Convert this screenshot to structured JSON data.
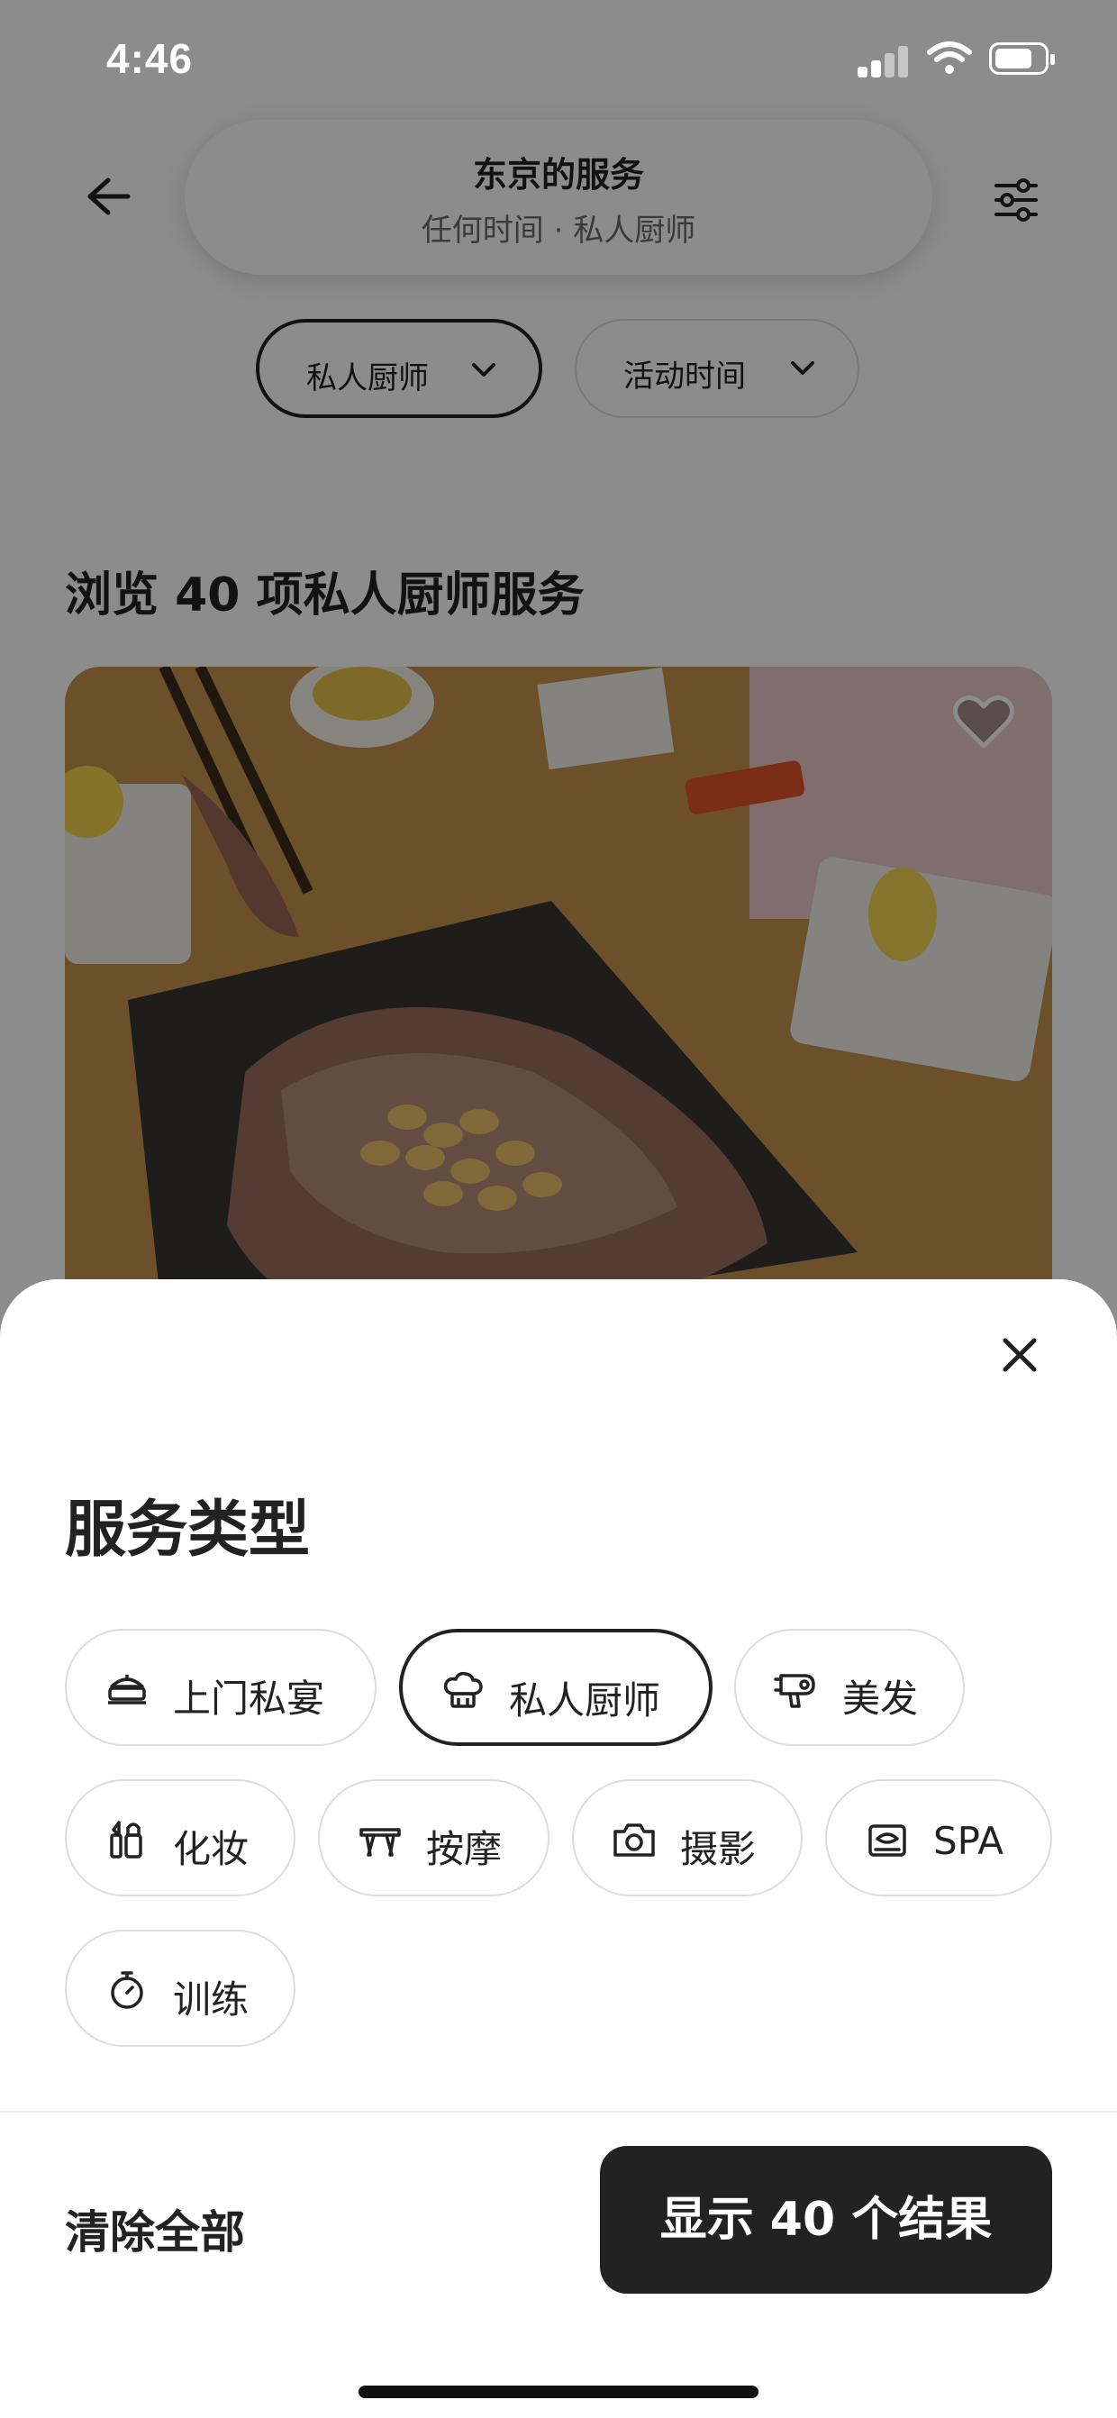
{
  "status_bar": {
    "time": "4:46"
  },
  "header": {
    "title": "东京的服务",
    "subtitle": "任何时间 · 私人厨师"
  },
  "filter_chips": [
    {
      "label": "私人厨师",
      "selected": true
    },
    {
      "label": "活动时间",
      "selected": false
    }
  ],
  "results_heading": "浏览 40 项私人厨师服务",
  "sheet": {
    "title": "服务类型",
    "service_types": [
      {
        "label": "上门私宴",
        "icon": "catering-icon",
        "selected": false
      },
      {
        "label": "私人厨师",
        "icon": "chef-hat-icon",
        "selected": true
      },
      {
        "label": "美发",
        "icon": "hair-dryer-icon",
        "selected": false
      },
      {
        "label": "化妆",
        "icon": "makeup-icon",
        "selected": false
      },
      {
        "label": "按摩",
        "icon": "massage-table-icon",
        "selected": false
      },
      {
        "label": "摄影",
        "icon": "camera-icon",
        "selected": false
      },
      {
        "label": "SPA",
        "icon": "spa-icon",
        "selected": false
      },
      {
        "label": "训练",
        "icon": "stopwatch-icon",
        "selected": false
      }
    ],
    "clear_label": "清除全部",
    "show_results_label": "显示 40 个结果"
  },
  "colors": {
    "text": "#222222",
    "primary_button": "#222222",
    "chip_border": "#dddddd"
  }
}
